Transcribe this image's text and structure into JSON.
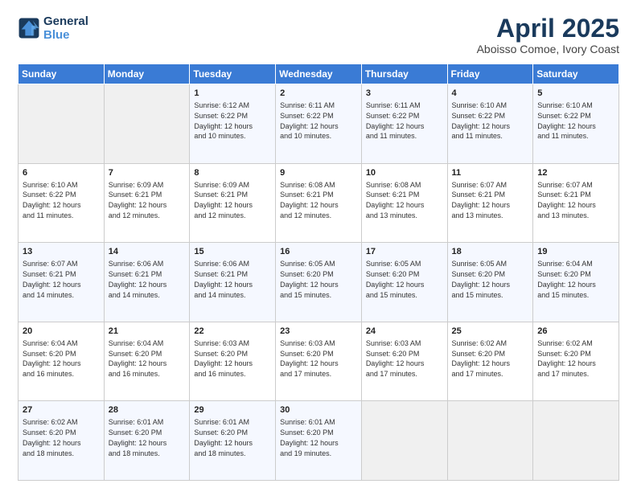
{
  "header": {
    "logo_line1": "General",
    "logo_line2": "Blue",
    "title": "April 2025",
    "subtitle": "Aboisso Comoe, Ivory Coast"
  },
  "weekdays": [
    "Sunday",
    "Monday",
    "Tuesday",
    "Wednesday",
    "Thursday",
    "Friday",
    "Saturday"
  ],
  "weeks": [
    [
      {
        "day": "",
        "info": ""
      },
      {
        "day": "",
        "info": ""
      },
      {
        "day": "1",
        "info": "Sunrise: 6:12 AM\nSunset: 6:22 PM\nDaylight: 12 hours\nand 10 minutes."
      },
      {
        "day": "2",
        "info": "Sunrise: 6:11 AM\nSunset: 6:22 PM\nDaylight: 12 hours\nand 10 minutes."
      },
      {
        "day": "3",
        "info": "Sunrise: 6:11 AM\nSunset: 6:22 PM\nDaylight: 12 hours\nand 11 minutes."
      },
      {
        "day": "4",
        "info": "Sunrise: 6:10 AM\nSunset: 6:22 PM\nDaylight: 12 hours\nand 11 minutes."
      },
      {
        "day": "5",
        "info": "Sunrise: 6:10 AM\nSunset: 6:22 PM\nDaylight: 12 hours\nand 11 minutes."
      }
    ],
    [
      {
        "day": "6",
        "info": "Sunrise: 6:10 AM\nSunset: 6:22 PM\nDaylight: 12 hours\nand 11 minutes."
      },
      {
        "day": "7",
        "info": "Sunrise: 6:09 AM\nSunset: 6:21 PM\nDaylight: 12 hours\nand 12 minutes."
      },
      {
        "day": "8",
        "info": "Sunrise: 6:09 AM\nSunset: 6:21 PM\nDaylight: 12 hours\nand 12 minutes."
      },
      {
        "day": "9",
        "info": "Sunrise: 6:08 AM\nSunset: 6:21 PM\nDaylight: 12 hours\nand 12 minutes."
      },
      {
        "day": "10",
        "info": "Sunrise: 6:08 AM\nSunset: 6:21 PM\nDaylight: 12 hours\nand 13 minutes."
      },
      {
        "day": "11",
        "info": "Sunrise: 6:07 AM\nSunset: 6:21 PM\nDaylight: 12 hours\nand 13 minutes."
      },
      {
        "day": "12",
        "info": "Sunrise: 6:07 AM\nSunset: 6:21 PM\nDaylight: 12 hours\nand 13 minutes."
      }
    ],
    [
      {
        "day": "13",
        "info": "Sunrise: 6:07 AM\nSunset: 6:21 PM\nDaylight: 12 hours\nand 14 minutes."
      },
      {
        "day": "14",
        "info": "Sunrise: 6:06 AM\nSunset: 6:21 PM\nDaylight: 12 hours\nand 14 minutes."
      },
      {
        "day": "15",
        "info": "Sunrise: 6:06 AM\nSunset: 6:21 PM\nDaylight: 12 hours\nand 14 minutes."
      },
      {
        "day": "16",
        "info": "Sunrise: 6:05 AM\nSunset: 6:20 PM\nDaylight: 12 hours\nand 15 minutes."
      },
      {
        "day": "17",
        "info": "Sunrise: 6:05 AM\nSunset: 6:20 PM\nDaylight: 12 hours\nand 15 minutes."
      },
      {
        "day": "18",
        "info": "Sunrise: 6:05 AM\nSunset: 6:20 PM\nDaylight: 12 hours\nand 15 minutes."
      },
      {
        "day": "19",
        "info": "Sunrise: 6:04 AM\nSunset: 6:20 PM\nDaylight: 12 hours\nand 15 minutes."
      }
    ],
    [
      {
        "day": "20",
        "info": "Sunrise: 6:04 AM\nSunset: 6:20 PM\nDaylight: 12 hours\nand 16 minutes."
      },
      {
        "day": "21",
        "info": "Sunrise: 6:04 AM\nSunset: 6:20 PM\nDaylight: 12 hours\nand 16 minutes."
      },
      {
        "day": "22",
        "info": "Sunrise: 6:03 AM\nSunset: 6:20 PM\nDaylight: 12 hours\nand 16 minutes."
      },
      {
        "day": "23",
        "info": "Sunrise: 6:03 AM\nSunset: 6:20 PM\nDaylight: 12 hours\nand 17 minutes."
      },
      {
        "day": "24",
        "info": "Sunrise: 6:03 AM\nSunset: 6:20 PM\nDaylight: 12 hours\nand 17 minutes."
      },
      {
        "day": "25",
        "info": "Sunrise: 6:02 AM\nSunset: 6:20 PM\nDaylight: 12 hours\nand 17 minutes."
      },
      {
        "day": "26",
        "info": "Sunrise: 6:02 AM\nSunset: 6:20 PM\nDaylight: 12 hours\nand 17 minutes."
      }
    ],
    [
      {
        "day": "27",
        "info": "Sunrise: 6:02 AM\nSunset: 6:20 PM\nDaylight: 12 hours\nand 18 minutes."
      },
      {
        "day": "28",
        "info": "Sunrise: 6:01 AM\nSunset: 6:20 PM\nDaylight: 12 hours\nand 18 minutes."
      },
      {
        "day": "29",
        "info": "Sunrise: 6:01 AM\nSunset: 6:20 PM\nDaylight: 12 hours\nand 18 minutes."
      },
      {
        "day": "30",
        "info": "Sunrise: 6:01 AM\nSunset: 6:20 PM\nDaylight: 12 hours\nand 19 minutes."
      },
      {
        "day": "",
        "info": ""
      },
      {
        "day": "",
        "info": ""
      },
      {
        "day": "",
        "info": ""
      }
    ]
  ]
}
